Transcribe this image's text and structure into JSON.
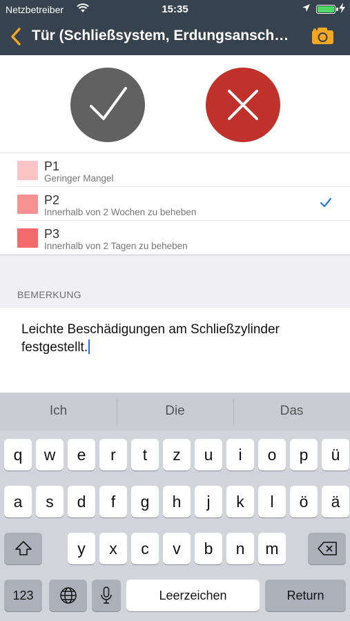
{
  "status_bar": {
    "carrier": "Netzbetreiber",
    "time": "15:35",
    "battery_level": 1.0,
    "wifi_icon": "wifi-icon",
    "location_icon": "location-arrow-icon"
  },
  "nav": {
    "title": "Tür (Schließsystem, Erdungsanschluss)",
    "back_icon": "chevron-left-icon",
    "camera_icon": "camera-icon"
  },
  "actions": {
    "accept_icon": "checkmark-icon",
    "reject_icon": "cross-icon",
    "accept_color": "#616161",
    "reject_color": "#c1312b"
  },
  "priorities": [
    {
      "name": "P1",
      "desc": "Geringer Mangel",
      "color": "#fcc4c4",
      "selected": false
    },
    {
      "name": "P2",
      "desc": "Innerhalb von 2 Wochen zu beheben",
      "color": "#f79292",
      "selected": true
    },
    {
      "name": "P3",
      "desc": "Innerhalb von 2 Tagen zu beheben",
      "color": "#f56b6b",
      "selected": false
    }
  ],
  "remark": {
    "header": "BEMERKUNG",
    "text": "Leichte Beschädigungen am Schließzylinder festgestellt."
  },
  "keyboard": {
    "predictions": [
      "Ich",
      "Die",
      "Das"
    ],
    "row1": [
      "q",
      "w",
      "e",
      "r",
      "t",
      "z",
      "u",
      "i",
      "o",
      "p",
      "ü"
    ],
    "row2": [
      "a",
      "s",
      "d",
      "f",
      "g",
      "h",
      "j",
      "k",
      "l",
      "ö",
      "ä"
    ],
    "row3": [
      "y",
      "x",
      "c",
      "v",
      "b",
      "n",
      "m"
    ],
    "numbers_label": "123",
    "space_label": "Leerzeichen",
    "return_label": "Return",
    "shift_icon": "shift-icon",
    "delete_icon": "delete-backspace-icon",
    "globe_icon": "globe-icon",
    "mic_icon": "microphone-icon"
  },
  "accent_color": "#f5a623",
  "checkmark_color": "#1a7bf2"
}
